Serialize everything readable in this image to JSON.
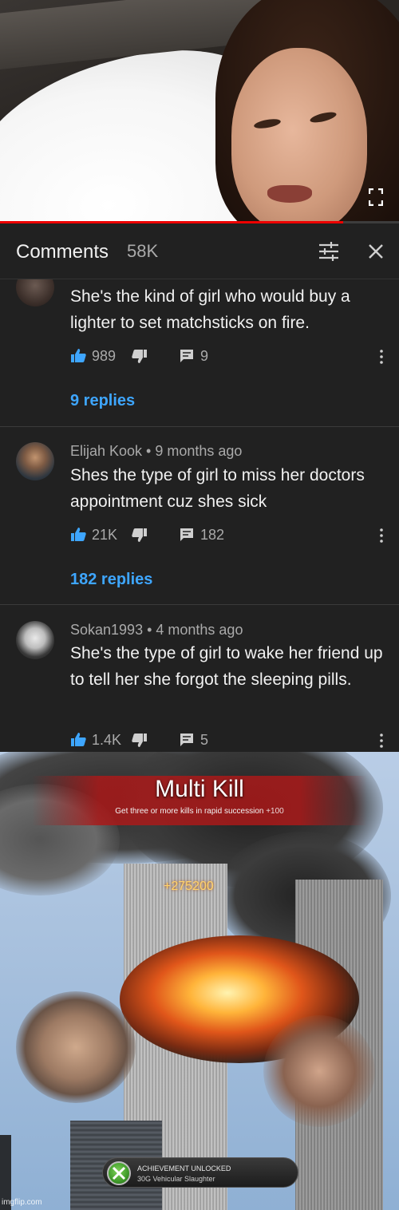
{
  "video": {
    "progress_fraction": 0.86,
    "progress_color": "#ee0000"
  },
  "comments_panel": {
    "title": "Comments",
    "count": "58K",
    "icons": [
      "filter-icon",
      "close-icon"
    ]
  },
  "comments": [
    {
      "author_meta": "",
      "text": "She's the kind of girl who would buy a lighter to set matchsticks on fire.",
      "likes": "989",
      "reply_count": "9",
      "replies_link": "9 replies"
    },
    {
      "author_meta": "Elijah Kook • 9 months ago",
      "text": "Shes the type of girl to miss her doctors appointment cuz shes sick",
      "likes": "21K",
      "reply_count": "182",
      "replies_link": "182 replies"
    },
    {
      "author_meta": "Sokan1993 • 4 months ago",
      "text": "She's the type of girl to wake her friend up to tell her she forgot the sleeping pills.",
      "likes": "1.4K",
      "reply_count": "5"
    }
  ],
  "meme": {
    "title": "Multi Kill",
    "subtitle": "Get three or more kills in rapid succession",
    "subtitle_points": "+100",
    "score": "+275200",
    "achievement_line1": "ACHIEVEMENT UNLOCKED",
    "achievement_line2": "30G Vehicular Slaughter",
    "watermark": "imgflip.com"
  },
  "colors": {
    "background": "#212121",
    "link_blue": "#3ea6ff",
    "like_blue": "#3ea6ff",
    "text_primary": "#f1f1f1",
    "text_secondary": "#aaaaaa"
  }
}
